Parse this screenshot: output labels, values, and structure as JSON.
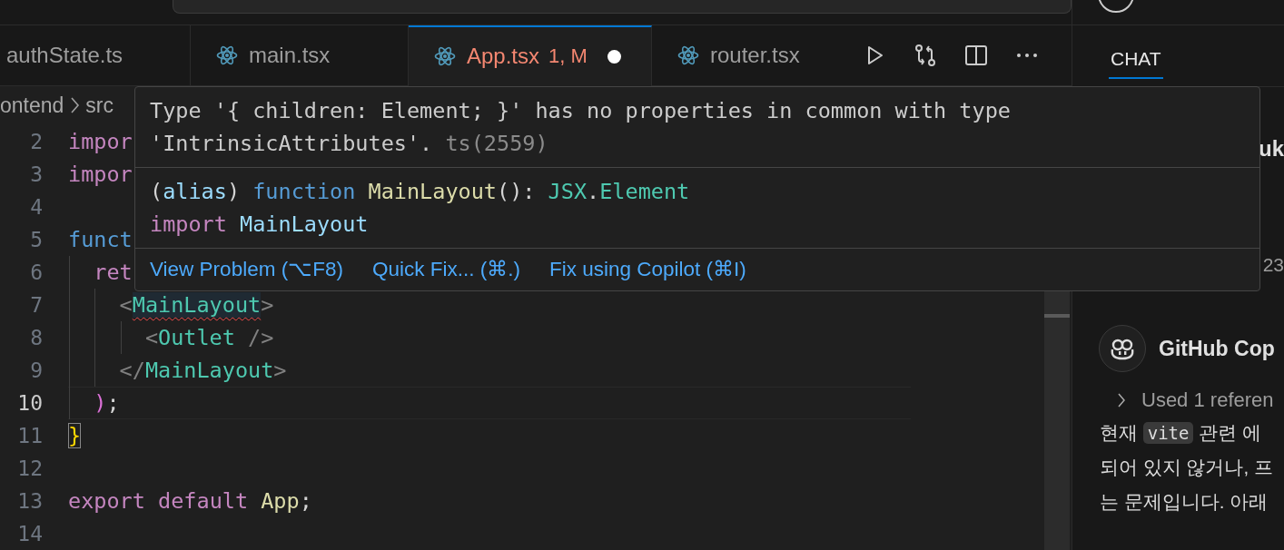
{
  "tabs": [
    {
      "label": "authState.ts",
      "selected": false,
      "modified": false,
      "error": false
    },
    {
      "label": "main.tsx",
      "selected": false,
      "modified": false,
      "error": false
    },
    {
      "label": "App.tsx",
      "badge": "1, M",
      "selected": true,
      "modified": true,
      "error": true
    },
    {
      "label": "router.tsx",
      "selected": false,
      "modified": false,
      "error": false
    }
  ],
  "editor_actions": [
    {
      "kind": "run"
    },
    {
      "kind": "compare"
    },
    {
      "kind": "split"
    },
    {
      "kind": "more"
    }
  ],
  "breadcrumb": [
    "ontend",
    "src"
  ],
  "code_lines": [
    {
      "number": "2",
      "current": false,
      "tokens": [
        {
          "text": "impor",
          "kind": "keyword"
        }
      ]
    },
    {
      "number": "3",
      "current": false,
      "tokens": [
        {
          "text": "impor",
          "kind": "keyword"
        }
      ]
    },
    {
      "number": "4",
      "current": false
    },
    {
      "number": "5",
      "current": false,
      "tokens": [
        {
          "text": "funct",
          "kind": "storage"
        }
      ]
    },
    {
      "number": "6",
      "current": false,
      "tokens": [
        {
          "text": "  ret",
          "kind": "keyword"
        }
      ]
    },
    {
      "number": "7",
      "current": false,
      "tokens": [
        {
          "text": "    <",
          "kind": "punct"
        },
        {
          "text": "MainLayout",
          "kind": "tag",
          "error": true
        },
        {
          "text": ">",
          "kind": "punct"
        }
      ]
    },
    {
      "number": "8",
      "current": false,
      "tokens": [
        {
          "text": "      <",
          "kind": "punct"
        },
        {
          "text": "Outlet",
          "kind": "tag"
        },
        {
          "text": " />",
          "kind": "punct"
        }
      ]
    },
    {
      "number": "9",
      "current": false,
      "tokens": [
        {
          "text": "    </",
          "kind": "punct"
        },
        {
          "text": "MainLayout",
          "kind": "tag"
        },
        {
          "text": ">",
          "kind": "punct"
        }
      ]
    },
    {
      "number": "10",
      "current": true,
      "tokens": [
        {
          "text": "  )",
          "kind": "paren"
        },
        {
          "text": ";",
          "kind": "plain"
        }
      ]
    },
    {
      "number": "11",
      "current": false,
      "tokens": [
        {
          "text": "}",
          "kind": "bracket",
          "matched": true
        }
      ]
    },
    {
      "number": "12",
      "current": false
    },
    {
      "number": "13",
      "current": false,
      "tokens": [
        {
          "text": "export default",
          "kind": "keyword"
        },
        {
          "text": " App",
          "kind": "fn"
        },
        {
          "text": ";",
          "kind": "plain"
        }
      ]
    },
    {
      "number": "14",
      "current": false
    }
  ],
  "hover": {
    "message": "Type '{ children: Element; }' has no properties in common with type 'IntrinsicAttributes'.",
    "source": "ts(2559)",
    "signature": [
      [
        {
          "text": "(",
          "kind": "plain"
        },
        {
          "text": "alias",
          "kind": "var"
        },
        {
          "text": ")",
          "kind": "plain"
        },
        {
          "text": " function",
          "kind": "storage"
        },
        {
          "text": " MainLayout",
          "kind": "fn"
        },
        {
          "text": "(): ",
          "kind": "plain"
        },
        {
          "text": "JSX",
          "kind": "tag"
        },
        {
          "text": ".",
          "kind": "plain"
        },
        {
          "text": "Element",
          "kind": "tag"
        }
      ],
      [
        {
          "text": "import",
          "kind": "keyword"
        },
        {
          "text": " MainLayout",
          "kind": "var"
        }
      ]
    ],
    "actions": [
      "View Problem (⌥F8)",
      "Quick Fix... (⌘.)",
      "Fix using Copilot (⌘I)"
    ]
  },
  "chat": {
    "tabs": [
      {
        "label": "CHAT",
        "selected": true
      }
    ],
    "hidden_title": "uk",
    "hidden_time": "23",
    "author": "GitHub Cop",
    "reference": "Used 1 referen",
    "lines": [
      [
        {
          "text": "현재 "
        },
        {
          "text": "vite",
          "kind": "code"
        },
        {
          "text": " 관련 에"
        }
      ],
      [
        {
          "text": "되어 있지 않거나, 프"
        }
      ],
      [
        {
          "text": "는 문제입니다. 아래"
        }
      ]
    ]
  }
}
